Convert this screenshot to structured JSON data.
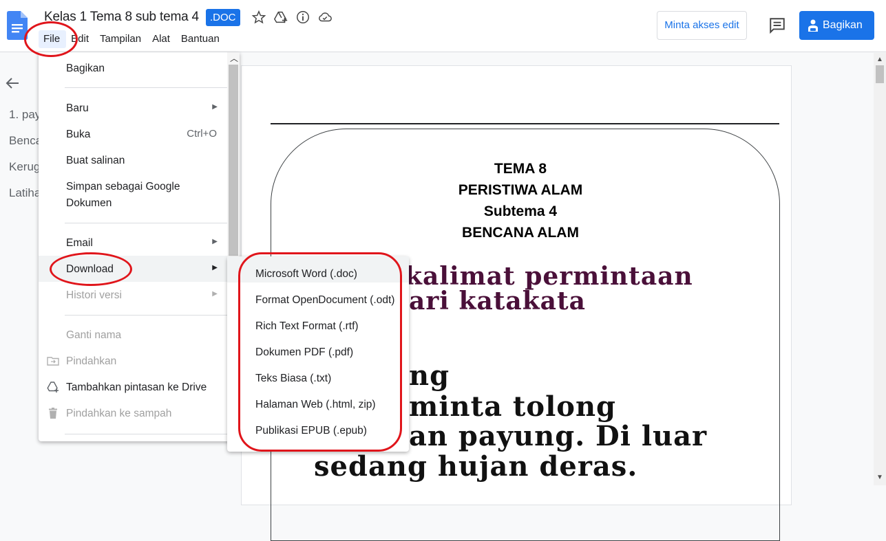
{
  "document": {
    "title": "Kelas 1 Tema 8 sub tema 4",
    "badge": ".DOC"
  },
  "icons": {
    "star": "star-icon",
    "drive": "add-to-drive-icon",
    "info": "info-icon",
    "cloud": "cloud-status-icon",
    "comment": "comment-icon",
    "share": "person-share-icon"
  },
  "menubar": {
    "items": [
      "File",
      "Edit",
      "Tampilan",
      "Alat",
      "Bantuan"
    ]
  },
  "header": {
    "edit_access_label": "Minta akses edit",
    "share_label": "Bagikan"
  },
  "outline": {
    "items": [
      "1. pay",
      "Benca",
      "Kerug",
      "Latiha"
    ]
  },
  "file_menu": {
    "share": "Bagikan",
    "new": "Baru",
    "open": "Buka",
    "open_shortcut": "Ctrl+O",
    "copy": "Buat salinan",
    "save_as_line1": "Simpan sebagai Google",
    "save_as_line2": "Dokumen",
    "email": "Email",
    "download": "Download",
    "version_history": "Histori versi",
    "rename": "Ganti nama",
    "move": "Pindahkan",
    "add_shortcut": "Tambahkan pintasan ke Drive",
    "trash": "Pindahkan ke sampah"
  },
  "download_menu": {
    "items": [
      "Microsoft Word (.doc)",
      "Format OpenDocument (.odt)",
      "Rich Text Format (.rtf)",
      "Dokumen PDF (.pdf)",
      "Teks Biasa (.txt)",
      "Halaman Web (.html, zip)",
      "Publikasi EPUB (.epub)"
    ]
  },
  "page": {
    "heading_lines": [
      "TEMA 8",
      "PERISTIWA ALAM",
      "Subtema 4",
      "BENCANA ALAM"
    ],
    "purple_lines": [
      "kalimat permintaan",
      "ari katakata"
    ],
    "body_lines": [
      "ng",
      "minta tolong",
      "an payung. Di luar",
      "sedang hujan deras."
    ]
  },
  "colors": {
    "accent": "#1a73e8",
    "annotation_red": "#e0151b",
    "purple_text": "#4a1039"
  }
}
